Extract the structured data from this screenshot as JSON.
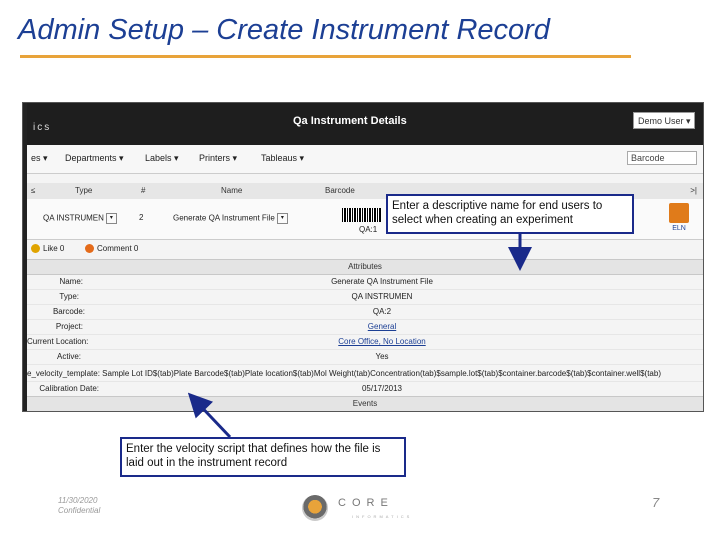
{
  "slide": {
    "title": "Admin Setup – Create Instrument Record",
    "footer_date": "11/30/2020",
    "footer_confidential": "Confidential",
    "page_number": "7",
    "logo_text": "CORE",
    "logo_subtext": "INFORMATICS",
    "title_color": "#1c3f94",
    "accent_color": "#e8a33a"
  },
  "app": {
    "brand_fragment": "ics",
    "window_title": "Qa Instrument Details",
    "user_select": "Demo User",
    "menu": [
      "es",
      "Departments",
      "Labels",
      "Printers",
      "Tableaus"
    ],
    "search_value": "Barcode",
    "grid": {
      "columns": [
        "Type",
        "#",
        "Name",
        "Barcode"
      ],
      "row": {
        "type": "QA INSTRUMEN",
        "number": "2",
        "name": "Generate QA Instrument File",
        "barcode": "QA:1"
      },
      "eln_label": "ELN"
    },
    "social": {
      "like_label": "Like",
      "like_count": "0",
      "comment_label": "Comment",
      "comment_count": "0"
    },
    "attributes_header": "Attributes",
    "attributes": [
      {
        "label": "Name:",
        "value": "Generate QA Instrument File"
      },
      {
        "label": "Type:",
        "value": "QA INSTRUMEN"
      },
      {
        "label": "Barcode:",
        "value": "QA:2"
      },
      {
        "label": "Project:",
        "value": "General",
        "link": true
      },
      {
        "label": "Current Location:",
        "value": "Core Office, No Location",
        "link": true
      },
      {
        "label": "Active:",
        "value": "Yes"
      }
    ],
    "velocity_row": "e_velocity_template: Sample Lot ID$(tab)Plate Barcode$(tab)Plate location$(tab)Mol Weight(tab)Concentration(tab)$sample.lot$(tab)$container.barcode$(tab)$container.well$(tab)",
    "calibration": {
      "label": "Calibration Date:",
      "value": "05/17/2013"
    },
    "events_header": "Events"
  },
  "callouts": {
    "name_hint": "Enter a descriptive name for end users to select when creating an experiment",
    "velocity_hint": "Enter the velocity script that defines how the file is laid out in the instrument record"
  }
}
